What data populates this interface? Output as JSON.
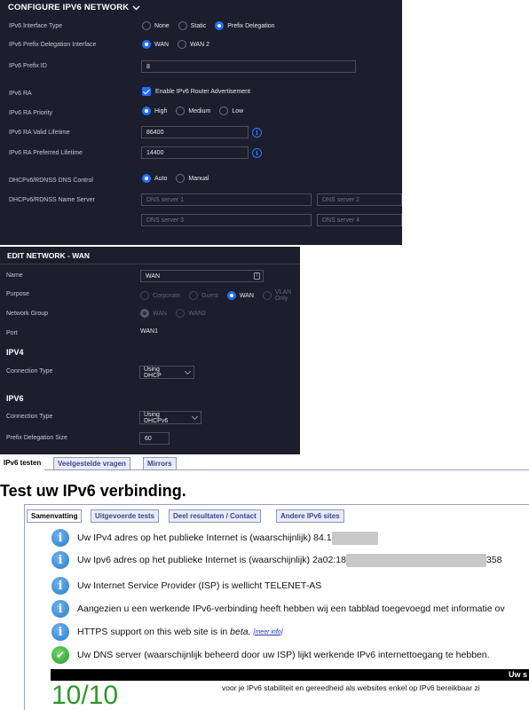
{
  "config_ipv6": {
    "title": "CONFIGURE IPV6 NETWORK",
    "interface_type_label": "IPv6 Interface Type",
    "interface_type_options": [
      "None",
      "Static",
      "Prefix Delegation"
    ],
    "interface_type_selected": "Prefix Delegation",
    "pd_interface_label": "IPv6 Prefix Delegation Interface",
    "pd_interface_options": [
      "WAN",
      "WAN 2"
    ],
    "pd_interface_selected": "WAN",
    "prefix_id_label": "IPv6 Prefix ID",
    "prefix_id_value": "8",
    "ra_label": "IPv6 RA",
    "ra_checkbox_label": "Enable IPv6 Router Advertisement",
    "ra_checked": true,
    "ra_priority_label": "IPv6 RA Priority",
    "ra_priority_options": [
      "High",
      "Medium",
      "Low"
    ],
    "ra_priority_selected": "High",
    "ra_valid_label": "IPv6 RA Valid Lifetime",
    "ra_valid_value": "86400",
    "ra_preferred_label": "IPv6 RA Preferred Lifetime",
    "ra_preferred_value": "14400",
    "dns_control_label": "DHCPv6/RDNSS DNS Control",
    "dns_control_options": [
      "Auto",
      "Manual"
    ],
    "dns_control_selected": "Auto",
    "dns_server_label": "DHCPv6/RDNSS Name Server",
    "dns_placeholders": [
      "DNS server 1",
      "DNS server 2",
      "DNS server 3",
      "DNS server 4"
    ]
  },
  "edit_network": {
    "title": "EDIT NETWORK - WAN",
    "name_label": "Name",
    "name_value": "WAN",
    "purpose_label": "Purpose",
    "purpose_options": [
      "Corporate",
      "Guest",
      "WAN",
      "VLAN Only"
    ],
    "purpose_selected": "WAN",
    "network_group_label": "Network Group",
    "network_group_options": [
      "WAN",
      "WAN2"
    ],
    "port_label": "Port",
    "port_value": "WAN1",
    "ipv4_heading": "IPV4",
    "ipv4_connection_label": "Connection Type",
    "ipv4_connection_value": "Using DHCP",
    "ipv6_heading": "IPV6",
    "ipv6_connection_label": "Connection Type",
    "ipv6_connection_value": "Using DHCPv6",
    "pd_size_label": "Prefix Delegation Size",
    "pd_size_value": "60"
  },
  "test_site": {
    "tabs": [
      "IPv6 testen",
      "Veelgestelde vragen",
      "Mirrors"
    ],
    "active_tab": "IPv6 testen",
    "heading": "Test uw IPv6 verbinding.",
    "inner_tabs": [
      "Samenvatting",
      "Uitgevoerde tests",
      "Deel resultaten / Contact",
      "Andere IPv6 sites"
    ],
    "active_inner_tab": "Samenvatting",
    "results": [
      {
        "icon": "info-icon",
        "text": "Uw IPv4 adres op het publieke Internet is (waarschijnlijk) 84.1"
      },
      {
        "icon": "info-icon",
        "text": "Uw Ipv6 adres op het publieke Internet is (waarschijnlijk) 2a02:18",
        "suffix": "358"
      },
      {
        "icon": "info-icon",
        "text": "Uw Internet Service Provider (ISP) is wellicht TELENET-AS"
      },
      {
        "icon": "info-icon",
        "text": "Aangezien u een werkende IPv6-verbinding heeft hebben wij een tabblad toegevoegd met informatie ov"
      },
      {
        "icon": "info-icon",
        "text": "HTTPS support on this web site is in",
        "emph": "beta.",
        "link": "[meer info]"
      },
      {
        "icon": "check-icon",
        "text": "Uw DNS server (waarschijnlijk beheerd door uw ISP) lijkt werkende IPv6 internettoegang te hebben."
      }
    ],
    "dark_bar_text": "Uw s",
    "score": "10/10",
    "footnote": "voor je IPv6 stabiliteit en gereedheid als websites enkel op IPv6 bereikbaar zi"
  },
  "colors": {
    "panel_bg": "#1c1e2d",
    "accent_blue": "#1f6fff",
    "score_green": "#2b9a2b"
  }
}
